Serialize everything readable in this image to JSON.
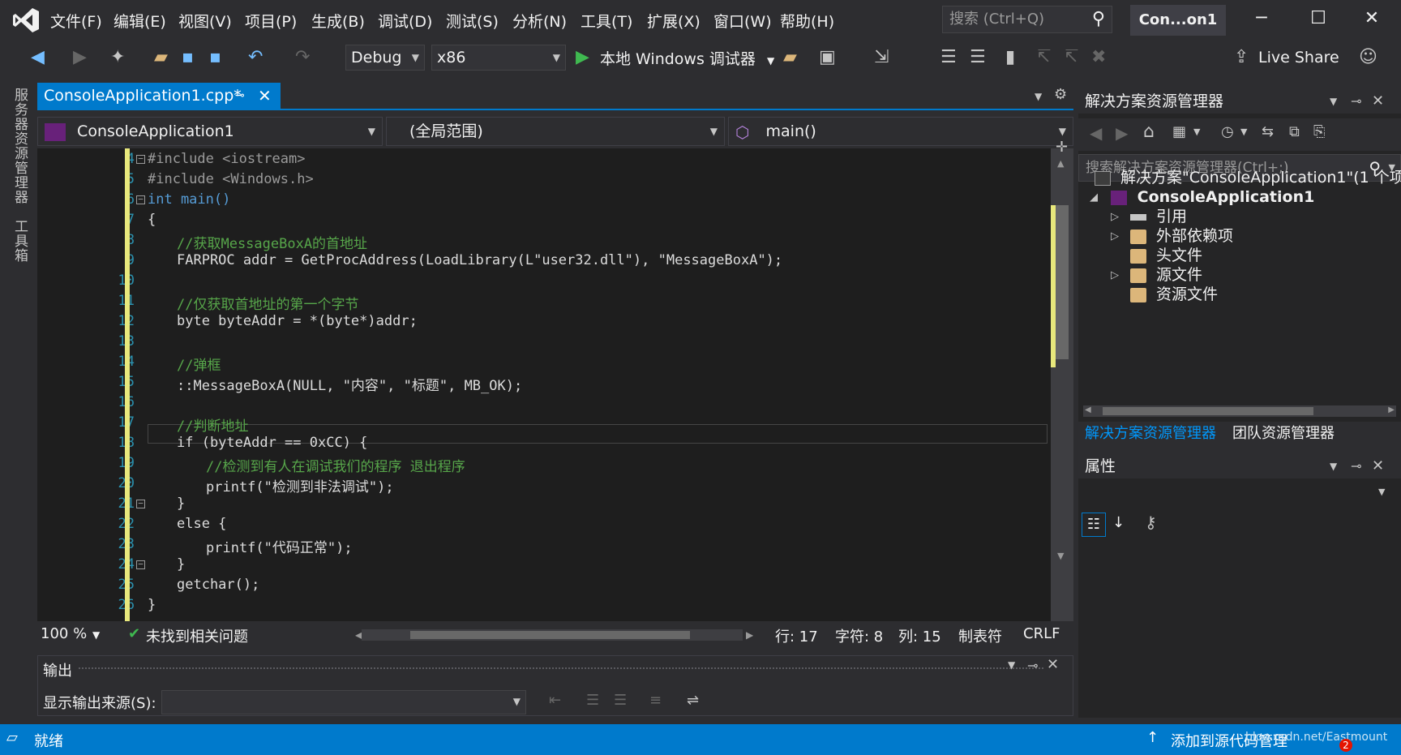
{
  "menu": {
    "items": [
      "文件(F)",
      "编辑(E)",
      "视图(V)",
      "项目(P)",
      "生成(B)",
      "调试(D)",
      "测试(S)",
      "分析(N)",
      "工具(T)",
      "扩展(X)",
      "窗口(W)",
      "帮助(H)"
    ]
  },
  "search": {
    "placeholder": "搜索 (Ctrl+Q)"
  },
  "solution_title": "Con...on1",
  "toolbar": {
    "config": "Debug",
    "platform": "x86",
    "run_label": "本地 Windows 调试器",
    "live_share": "Live Share"
  },
  "left_strip": {
    "server_explorer": "服务器资源管理器",
    "toolbox": "工具箱"
  },
  "editor": {
    "tab_label": "ConsoleApplication1.cpp*",
    "nav_project": "ConsoleApplication1",
    "nav_scope": "(全局范围)",
    "nav_member": "main()",
    "line_numbers": [
      "4",
      "5",
      "6",
      "7",
      "8",
      "9",
      "10",
      "11",
      "12",
      "13",
      "14",
      "15",
      "16",
      "17",
      "18",
      "19",
      "20",
      "21",
      "22",
      "23",
      "24",
      "25",
      "26"
    ],
    "code_lines": {
      "l4": "#include <iostream>",
      "l5": "#include <Windows.h>",
      "l6": "int main()",
      "l7": "{",
      "l8": "//获取MessageBoxA的首地址",
      "l9": "FARPROC addr = GetProcAddress(LoadLibrary(L\"user32.dll\"), \"MessageBoxA\");",
      "l11": "//仅获取首地址的第一个字节",
      "l12": "byte byteAddr = *(byte*)addr;",
      "l14": "//弹框",
      "l15": "::MessageBoxA(NULL, \"内容\", \"标题\", MB_OK);",
      "l17": "//判断地址",
      "l18": "if (byteAddr == 0xCC) {",
      "l19": "//检测到有人在调试我们的程序 退出程序",
      "l20": "printf(\"检测到非法调试\");",
      "l21": "}",
      "l22": "else {",
      "l23": "printf(\"代码正常\");",
      "l24": "}",
      "l25": "getchar();",
      "l26": "}"
    }
  },
  "editor_status": {
    "zoom": "100 %",
    "issues": "未找到相关问题",
    "row": "行: 17",
    "char": "字符: 8",
    "col": "列: 15",
    "tabs": "制表符",
    "eol": "CRLF"
  },
  "output": {
    "title": "输出",
    "source_label": "显示输出来源(S):"
  },
  "solution_explorer": {
    "title": "解决方案资源管理器",
    "search_placeholder": "搜索解决方案资源管理器(Ctrl+;)",
    "solution_node": "解决方案\"ConsoleApplication1\"(1 个项目",
    "project_node": "ConsoleApplication1",
    "children": [
      "引用",
      "外部依赖项",
      "头文件",
      "源文件",
      "资源文件"
    ],
    "tab_solution": "解决方案资源管理器",
    "tab_team": "团队资源管理器"
  },
  "properties": {
    "title": "属性"
  },
  "statusbar": {
    "ready": "就绪",
    "source_control": "添加到源代码管理",
    "watermark": "blog.csdn.net/Eastmount",
    "badge": "2"
  },
  "colors": {
    "accent": "#007acc",
    "editor_bg": "#1e1e1e",
    "chrome_bg": "#2d2d30",
    "keyword": "#569cd6",
    "comment": "#57a64a",
    "string": "#d69d85",
    "line_number": "#2b91af",
    "change_marker": "#e8e87c"
  }
}
